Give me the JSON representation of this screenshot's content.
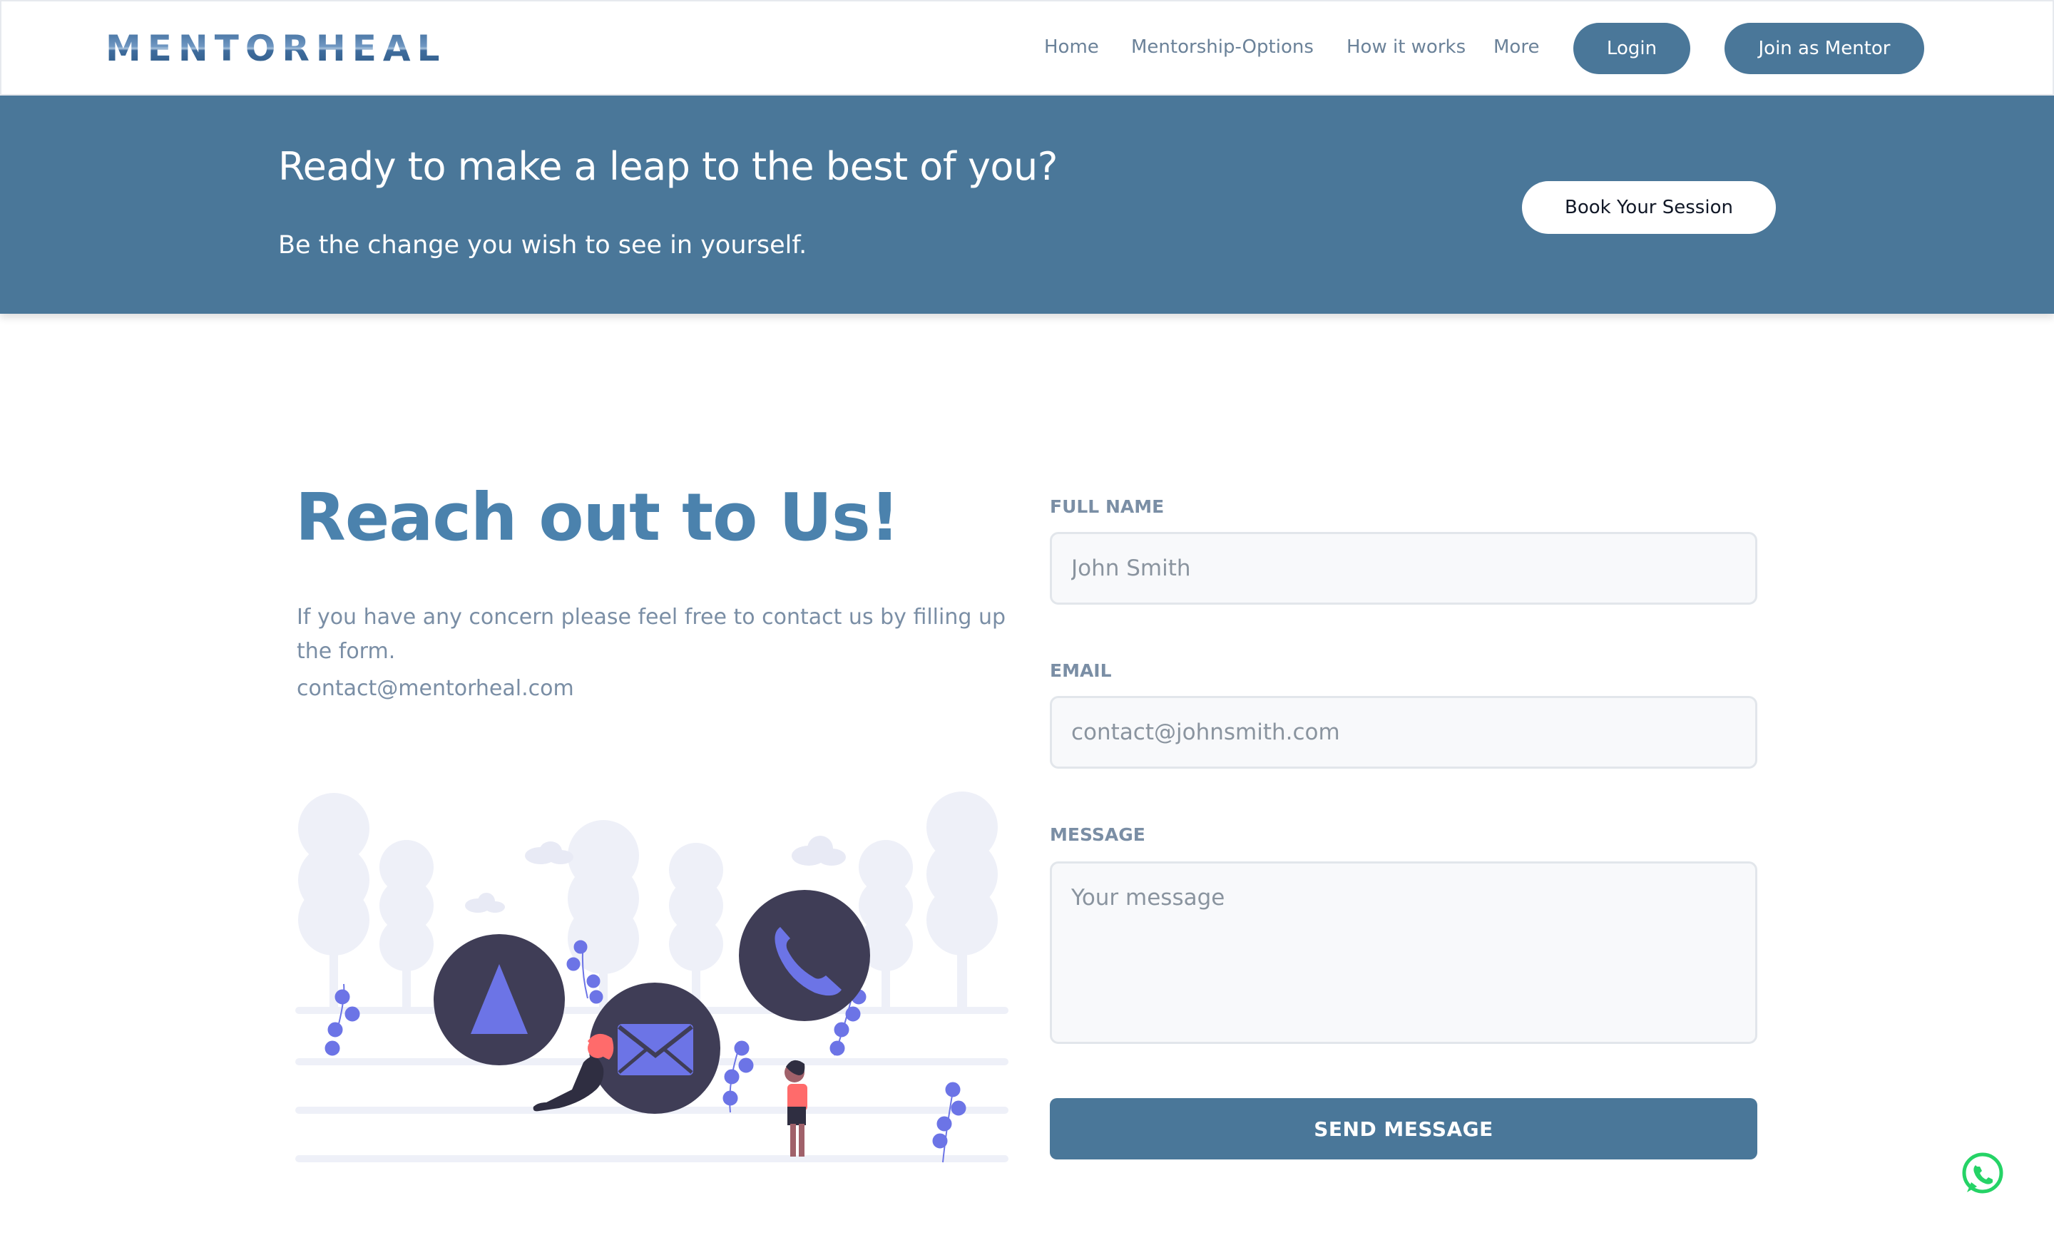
{
  "brand": {
    "logo_text": "MENTORHEAL"
  },
  "nav": {
    "links": [
      "Home",
      "Mentorship-Options",
      "How it works",
      "More"
    ],
    "login_label": "Login",
    "join_label": "Join as Mentor"
  },
  "banner": {
    "title": "Ready to make a leap to the best of you?",
    "subtitle": "Be the change you wish to see in yourself.",
    "cta_label": "Book Your Session"
  },
  "contact": {
    "title": "Reach out to Us!",
    "description": "If you have any concern please feel free to contact us by filling up the form.",
    "email": "contact@mentorheal.com"
  },
  "form": {
    "full_name_label": "FULL NAME",
    "full_name_placeholder": "John Smith",
    "email_label": "EMAIL",
    "email_placeholder": "contact@johnsmith.com",
    "message_label": "MESSAGE",
    "message_placeholder": "Your message",
    "submit_label": "SEND MESSAGE"
  },
  "icons": {
    "navigation": "navigation-arrow-icon",
    "mail": "mail-icon",
    "phone": "phone-icon",
    "chat": "whatsapp-icon"
  },
  "colors": {
    "primary": "#4a7799",
    "heading": "#4b82ad",
    "muted_text": "#7a8ea5",
    "whatsapp": "#25d366"
  }
}
